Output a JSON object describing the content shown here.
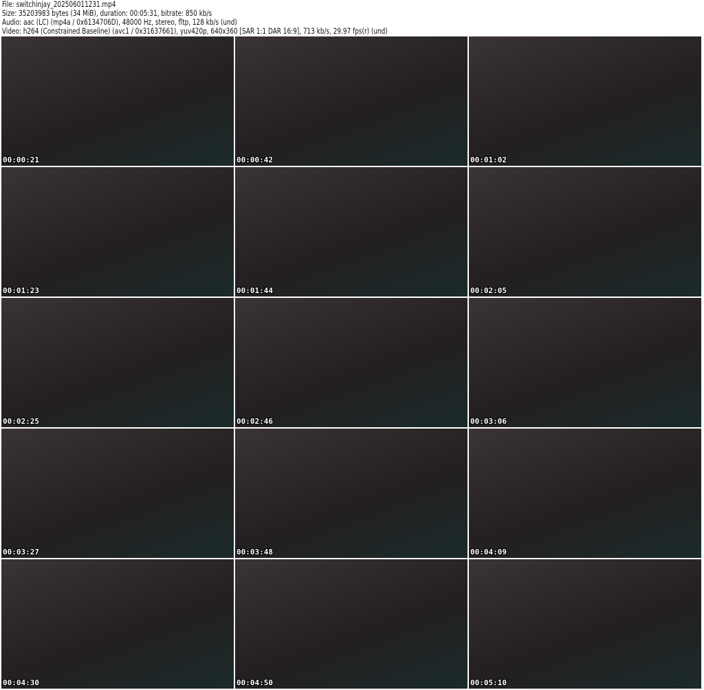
{
  "header": {
    "file": "File: switchinjay_202506011231.mp4",
    "size": "Size: 35203983 bytes (34 MiB), duration: 00:05:31, bitrate: 850 kb/s",
    "audio": "Audio: aac (LC) (mp4a / 0x6134706D), 48000 Hz, stereo, fltp, 128 kb/s (und)",
    "video": "Video: h264 (Constrained Baseline) (avc1 / 0x31637661), yuv420p, 640x360 [SAR 1:1 DAR 16:9], 713 kb/s, 29.97 fps(r) (und)"
  },
  "thumbnails": [
    {
      "timestamp": "00:00:21"
    },
    {
      "timestamp": "00:00:42"
    },
    {
      "timestamp": "00:01:02"
    },
    {
      "timestamp": "00:01:23"
    },
    {
      "timestamp": "00:01:44"
    },
    {
      "timestamp": "00:02:05"
    },
    {
      "timestamp": "00:02:25"
    },
    {
      "timestamp": "00:02:46"
    },
    {
      "timestamp": "00:03:06"
    },
    {
      "timestamp": "00:03:27"
    },
    {
      "timestamp": "00:03:48"
    },
    {
      "timestamp": "00:04:09"
    },
    {
      "timestamp": "00:04:30"
    },
    {
      "timestamp": "00:04:50"
    },
    {
      "timestamp": "00:05:10"
    }
  ]
}
